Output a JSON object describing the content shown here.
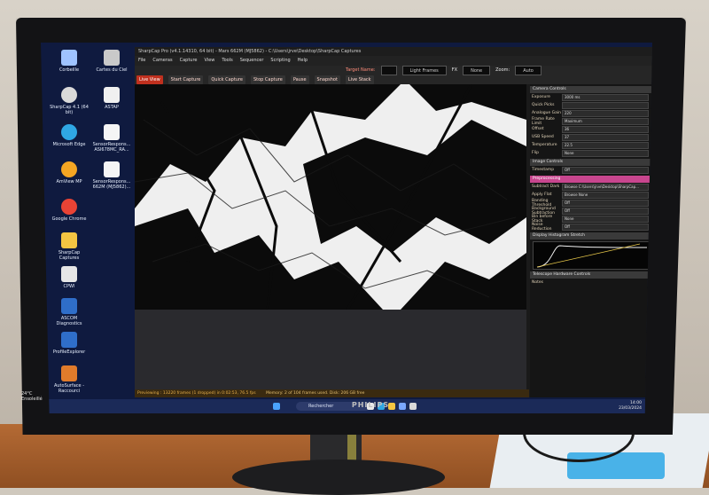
{
  "desktop": {
    "icons": [
      {
        "label": "Corbeille",
        "color": "#9fc3ff"
      },
      {
        "label": "Cartes du Ciel",
        "color": "#c9c9c9"
      },
      {
        "label": "SharpCap 4.1 (64 bit)",
        "color": "#d9d9d9"
      },
      {
        "label": "ASTAP",
        "color": "#f0f0f0"
      },
      {
        "label": "Microsoft Edge",
        "color": "#2fa7e4"
      },
      {
        "label": "SensorRespons... ASI678MC_RA...",
        "color": "#f5f5f5"
      },
      {
        "label": "AmView MP",
        "color": "#f5a623"
      },
      {
        "label": "SensorRespons... 662M (MJ5862)...",
        "color": "#f5f5f5"
      },
      {
        "label": "Google Chrome",
        "color": "#e94335"
      },
      {
        "label": "SharpCap Captures",
        "color": "#f4c542"
      },
      {
        "label": "CPWI",
        "color": "#e6e6e6"
      },
      {
        "label": "ASCOM Diagnostics",
        "color": "#2f6ec9"
      },
      {
        "label": "ProfileExplorer",
        "color": "#2f6ec9"
      },
      {
        "label": "AutoSurface - Raccourci",
        "color": "#e07b2b"
      }
    ]
  },
  "app": {
    "title": "SharpCap Pro (v4.1.14310, 64 bit) - Mars 662M (MJ5862) - C:\\Users\\jrve\\Desktop\\SharpCap Captures",
    "menu": [
      "File",
      "Cameras",
      "Capture",
      "View",
      "Tools",
      "Sequencer",
      "Scripting",
      "Help"
    ],
    "toolbar_row1": {
      "target_name": "Target Name:",
      "frames": "Light Frames",
      "fx": "FX",
      "fx_value": "None",
      "zoom_label": "Zoom:",
      "zoom_value": "Auto"
    },
    "toolbar_row2": [
      "Live View",
      "Start Capture",
      "Quick Capture",
      "Stop Capture",
      "Pause",
      "Snapshot",
      "Live Stack"
    ],
    "status_left": "Previewing : 13220 frames (1 dropped) in 0:02:53, 76.5 fps",
    "status_right": "Memory: 2 of 104 frames used. Disk: 206 GB free"
  },
  "panel": {
    "camera_controls": "Camera Controls",
    "rows": [
      {
        "label": "Exposure",
        "value": "3000 ms"
      },
      {
        "label": "Quick Picks",
        "value": ""
      },
      {
        "label": "Analogue Gain",
        "value": "220"
      },
      {
        "label": "Frame Rate Limit",
        "value": "Maximum"
      },
      {
        "label": "Offset",
        "value": "36"
      },
      {
        "label": "USB Speed",
        "value": "37"
      },
      {
        "label": "Temperature",
        "value": "22.5"
      },
      {
        "label": "Flip",
        "value": "None"
      }
    ],
    "image_controls": "Image Controls",
    "image_rows": [
      {
        "label": "Timestamp",
        "value": "Off"
      }
    ],
    "preprocessing": "Preprocessing",
    "pre_rows": [
      {
        "label": "Subtract Dark",
        "value": "Browse  C:\\Users\\jrve\\Desktop\\SharpCap..."
      },
      {
        "label": "Apply Flat",
        "value": "Browse  None"
      },
      {
        "label": "Banding Threshold",
        "value": "Off"
      },
      {
        "label": "Background Subtraction",
        "value": "Off"
      },
      {
        "label": "Bin before Stack",
        "value": "None"
      },
      {
        "label": "Noise Reduction",
        "value": "Off"
      }
    ],
    "histogram": "Display Histogram Stretch",
    "hardware": "Telescope Hardware Controls",
    "notes": "Notes"
  },
  "taskbar": {
    "search": "Rechercher",
    "time": "14:00",
    "date": "23/03/2024"
  },
  "weather": {
    "temp": "24°C",
    "cond": "Ensoleillé"
  },
  "monitor": {
    "brand": "PHILIPS"
  }
}
